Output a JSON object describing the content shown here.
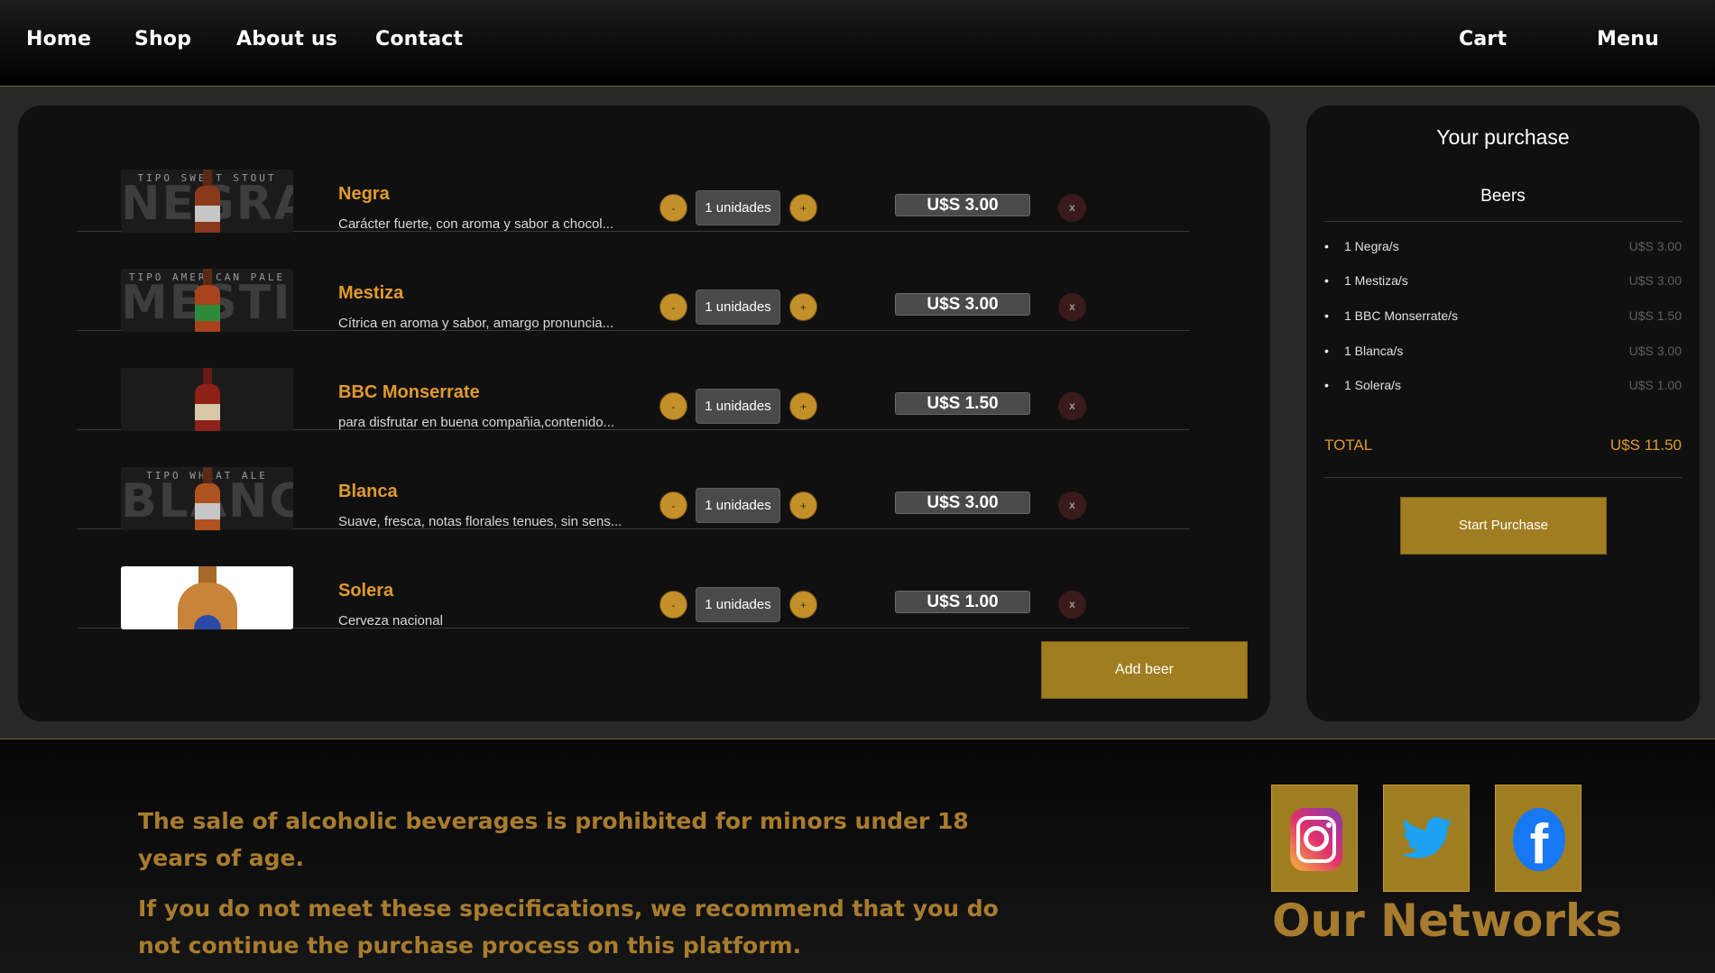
{
  "nav": {
    "home": "Home",
    "shop": "Shop",
    "about": "About us",
    "contact": "Contact",
    "cart": "Cart",
    "menu": "Menu"
  },
  "cart": {
    "items": [
      {
        "name": "Negra",
        "description": "Carácter fuerte, con aroma y sabor a chocol...",
        "quantity": "1 unidades",
        "price": "U$S 3.00",
        "image_big": "NEGRA",
        "image_small": "TIPO SWEET STOUT"
      },
      {
        "name": "Mestiza",
        "description": "Cítrica en aroma y sabor, amargo pronuncia...",
        "quantity": "1 unidades",
        "price": "U$S 3.00",
        "image_big": "MESTIZA",
        "image_small": "TIPO AMERICAN PALE ALE"
      },
      {
        "name": "BBC Monserrate",
        "description": "para disfrutar en buena compañia,contenido...",
        "quantity": "1 unidades",
        "price": "U$S 1.50",
        "image_big": "",
        "image_small": ""
      },
      {
        "name": "Blanca",
        "description": "Suave, fresca, notas florales tenues, sin sens...",
        "quantity": "1 unidades",
        "price": "U$S 3.00",
        "image_big": "BLANCA",
        "image_small": "TIPO WHEAT ALE"
      },
      {
        "name": "Solera",
        "description": "Cerveza nacional",
        "quantity": "1 unidades",
        "price": "U$S 1.00",
        "image_big": "",
        "image_small": ""
      }
    ],
    "minus_label": "-",
    "plus_label": "+",
    "remove_label": "x",
    "add_beer": "Add beer"
  },
  "summary": {
    "title": "Your purchase",
    "subtitle": "Beers",
    "lines": [
      {
        "bullet": "•",
        "name": "1 Negra/s",
        "amount": "U$S 3.00"
      },
      {
        "bullet": "•",
        "name": "1 Mestiza/s",
        "amount": "U$S 3.00"
      },
      {
        "bullet": "•",
        "name": "1 BBC Monserrate/s",
        "amount": "U$S 1.50"
      },
      {
        "bullet": "•",
        "name": "1 Blanca/s",
        "amount": "U$S 3.00"
      },
      {
        "bullet": "•",
        "name": "1 Solera/s",
        "amount": "U$S 1.00"
      }
    ],
    "total_label": "TOTAL",
    "total_value": "U$S 11.50",
    "start_button": "Start Purchase"
  },
  "footer": {
    "warning_1": "The sale of alcoholic beverages is prohibited for minors under 18 years of age.",
    "warning_2": "If you do not meet these specifications, we recommend that you do not continue the purchase process on this platform.",
    "networks_title": "Our Networks",
    "social_icons": [
      "instagram-icon",
      "twitter-icon",
      "facebook-icon"
    ],
    "fb_glyph": "f"
  },
  "colors": {
    "accent": "#e09a2c",
    "button": "#a07d20",
    "panel": "#101010",
    "background": "#282828"
  }
}
